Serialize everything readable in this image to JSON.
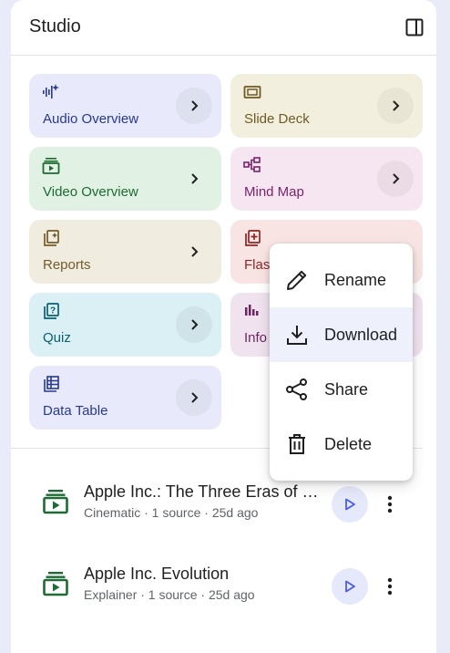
{
  "header": {
    "title": "Studio",
    "toggle_icon": "side-panel-icon"
  },
  "cards": [
    {
      "label": "Audio Overview",
      "icon": "audio-waveform-icon"
    },
    {
      "label": "Slide Deck",
      "icon": "slides-icon"
    },
    {
      "label": "Video Overview",
      "icon": "video-icon"
    },
    {
      "label": "Mind Map",
      "icon": "mind-map-icon"
    },
    {
      "label": "Reports",
      "icon": "reports-icon"
    },
    {
      "label": "Flas",
      "icon": "flashcards-icon"
    },
    {
      "label": "Quiz",
      "icon": "quiz-icon"
    },
    {
      "label": "Info",
      "icon": "infographic-icon"
    },
    {
      "label": "Data Table",
      "icon": "table-icon"
    }
  ],
  "items": [
    {
      "title": "Apple Inc.: The Three Eras of Innovation",
      "meta": "Cinematic · 1 source · 25d ago"
    },
    {
      "title": "Apple Inc. Evolution",
      "meta": "Explainer · 1 source · 25d ago"
    }
  ],
  "menu": {
    "items": [
      {
        "label": "Rename",
        "icon": "pencil-icon"
      },
      {
        "label": "Download",
        "icon": "download-icon"
      },
      {
        "label": "Share",
        "icon": "share-icon"
      },
      {
        "label": "Delete",
        "icon": "trash-icon"
      }
    ],
    "highlighted": "Download"
  },
  "colors": {
    "accent": "#4a5ce8",
    "background": "#e9ecf8",
    "video_icon": "#1e6b34"
  }
}
